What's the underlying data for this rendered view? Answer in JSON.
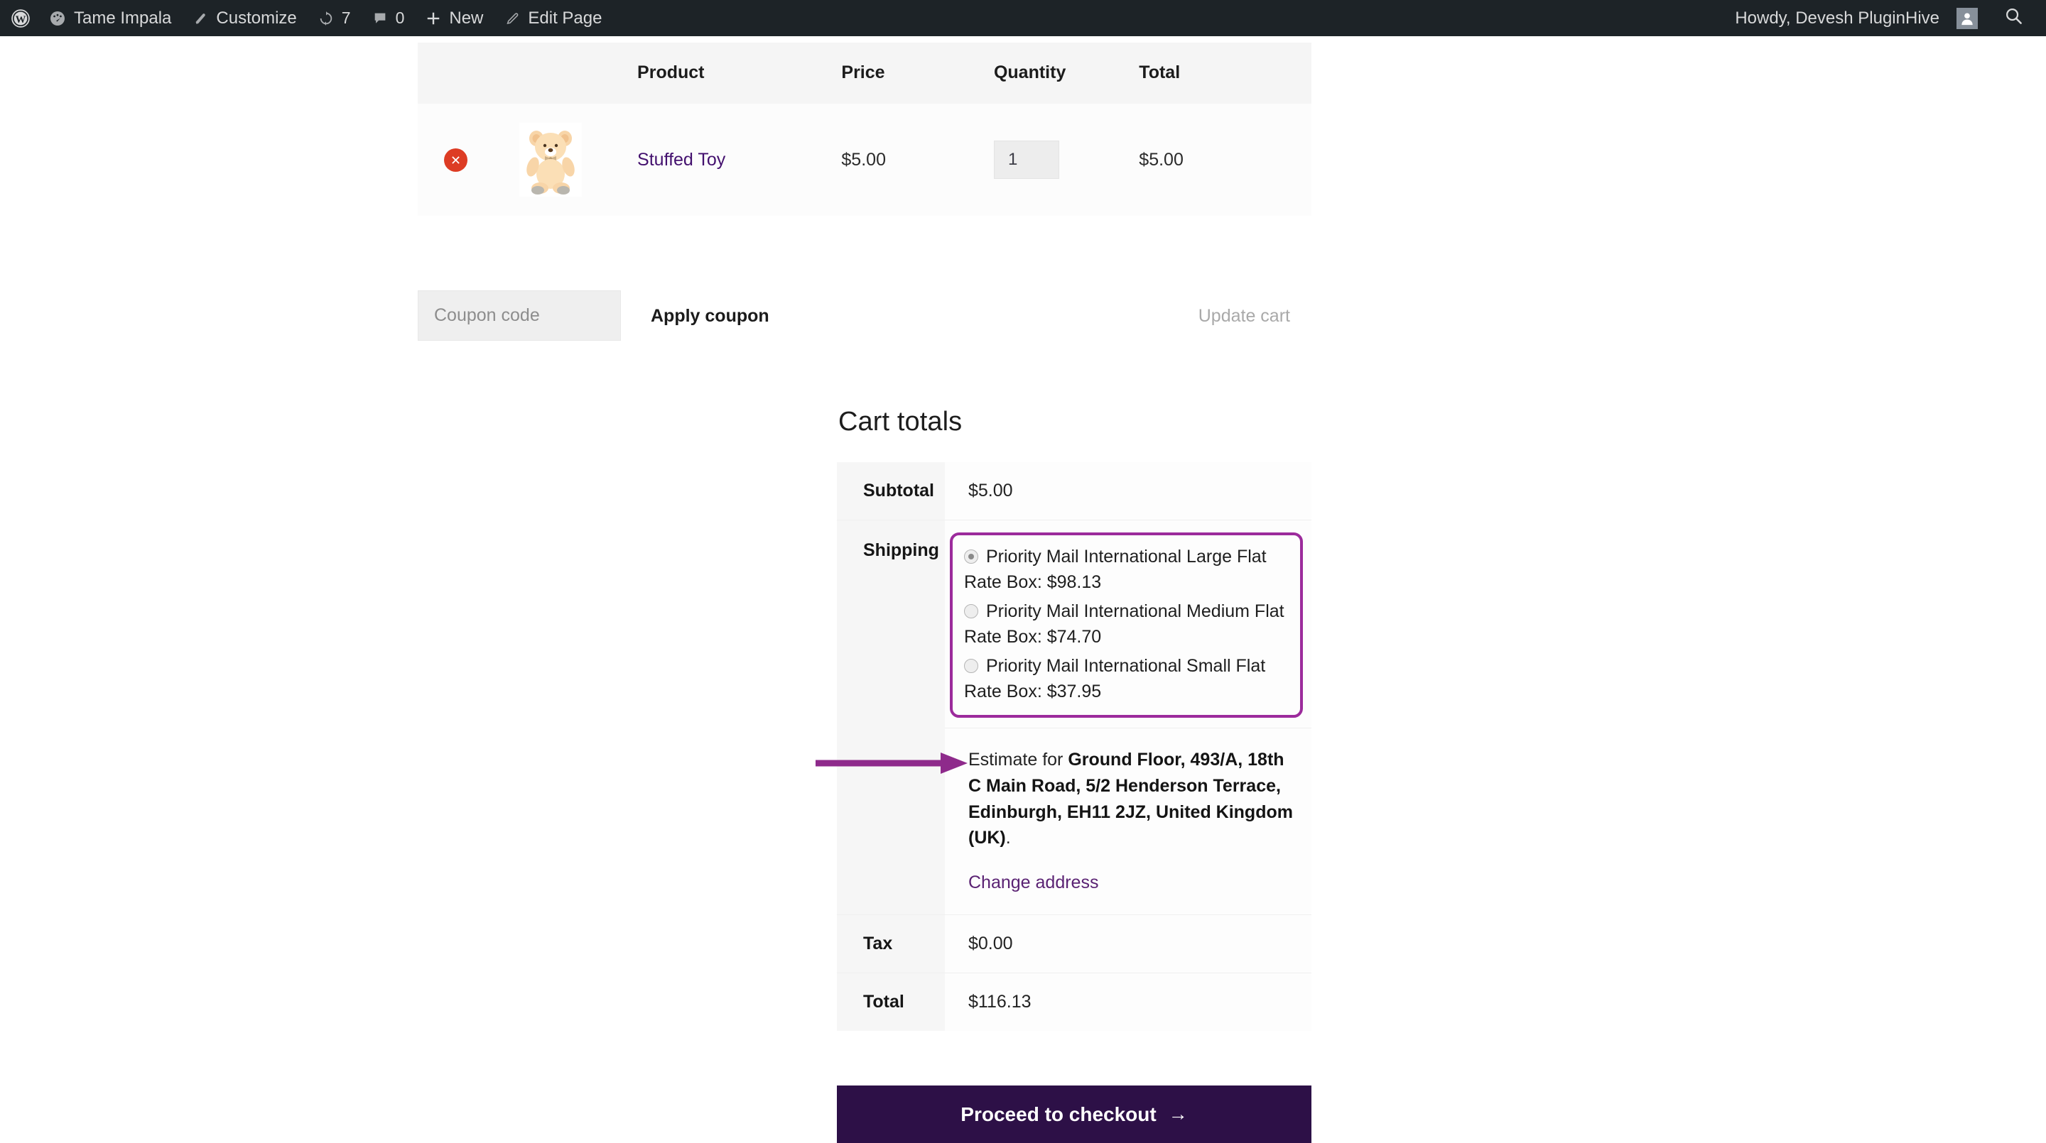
{
  "adminbar": {
    "site_name": "Tame Impala",
    "customize": "Customize",
    "updates_count": "7",
    "comments_count": "0",
    "new": "New",
    "edit_page": "Edit Page",
    "howdy": "Howdy, Devesh PluginHive"
  },
  "cart": {
    "headers": {
      "product": "Product",
      "price": "Price",
      "quantity": "Quantity",
      "total": "Total"
    },
    "item": {
      "name": "Stuffed Toy",
      "price": "$5.00",
      "quantity": "1",
      "line_total": "$5.00"
    },
    "coupon": {
      "placeholder": "Coupon code",
      "value": "",
      "apply_label": "Apply coupon",
      "update_label": "Update cart"
    }
  },
  "totals": {
    "title": "Cart totals",
    "subtotal_label": "Subtotal",
    "subtotal_value": "$5.00",
    "shipping_label": "Shipping",
    "shipping_options": [
      {
        "label": "Priority Mail International Large Flat Rate Box: $98.13",
        "selected": true
      },
      {
        "label": "Priority Mail International Medium Flat Rate Box: $74.70",
        "selected": false
      },
      {
        "label": "Priority Mail International Small Flat Rate Box: $37.95",
        "selected": false
      }
    ],
    "estimate_prefix": "Estimate for ",
    "estimate_address": "Ground Floor, 493/A, 18th C Main Road, 5/2 Henderson Terrace, Edinburgh, EH11 2JZ, United Kingdom (UK)",
    "estimate_suffix": ".",
    "change_address_label": "Change address",
    "tax_label": "Tax",
    "tax_value": "$0.00",
    "total_label": "Total",
    "total_value": "$116.13"
  },
  "checkout": {
    "label": "Proceed to checkout",
    "arrow_glyph": "→"
  },
  "colors": {
    "admin_bar_bg": "#1d2327",
    "annotation_purple": "#9c2b9c",
    "checkout_bg": "#2d1047",
    "product_link": "#43106e",
    "remove_red": "#dd3c24"
  }
}
